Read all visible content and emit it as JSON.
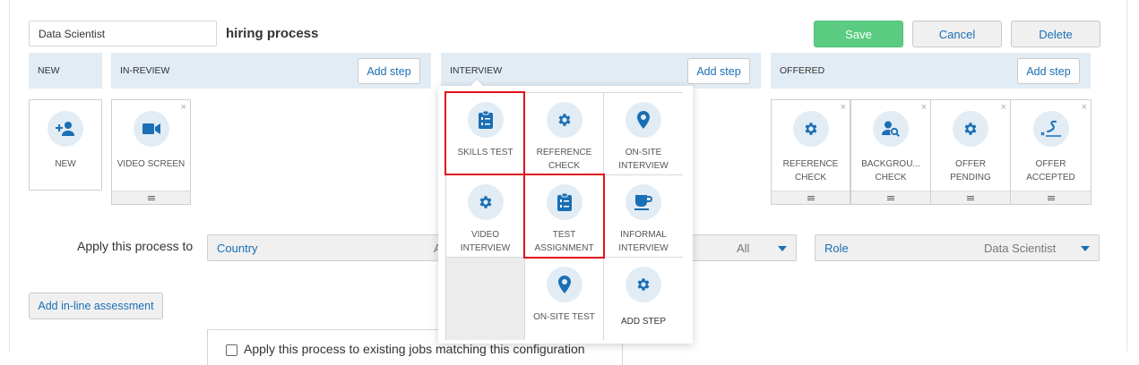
{
  "process": {
    "job_name": "Data Scientist",
    "title": "hiring process"
  },
  "actions": {
    "save": "Save",
    "cancel": "Cancel",
    "delete": "Delete"
  },
  "columns": {
    "new": {
      "label": "NEW"
    },
    "in_review": {
      "label": "IN-REVIEW",
      "add_step": "Add step"
    },
    "interview": {
      "label": "INTERVIEW",
      "add_step": "Add step"
    },
    "offered": {
      "label": "OFFERED",
      "add_step": "Add step"
    }
  },
  "cards": {
    "new": {
      "label": "NEW",
      "icon": "add-person-icon"
    },
    "video_screen": {
      "label": "VIDEO SCREEN",
      "icon": "video-camera-icon"
    },
    "reference_check": {
      "label": "REFERENCE CHECK",
      "icon": "gear-icon"
    },
    "background_check": {
      "label": "BACKGROU... CHECK",
      "icon": "person-search-icon"
    },
    "offer_pending": {
      "label": "OFFER PENDING",
      "icon": "gear-icon"
    },
    "offer_accepted": {
      "label": "OFFER ACCEPTED",
      "icon": "signature-icon"
    },
    "close_glyph": "×"
  },
  "step_picker": {
    "items": [
      {
        "label": "SKILLS TEST",
        "icon": "clipboard-list-icon",
        "highlighted": true
      },
      {
        "label": "REFERENCE CHECK",
        "icon": "gear-icon"
      },
      {
        "label": "ON-SITE INTERVIEW",
        "icon": "map-pin-icon"
      },
      {
        "label": "VIDEO INTERVIEW",
        "icon": "gear-icon"
      },
      {
        "label": "TEST ASSIGNMENT",
        "icon": "clipboard-list-icon",
        "highlighted": true
      },
      {
        "label": "INFORMAL INTERVIEW",
        "icon": "coffee-cup-icon"
      },
      {
        "label": "ON-SITE TEST",
        "icon": "map-pin-icon"
      },
      {
        "label": "ADD STEP",
        "icon": "gear-icon"
      }
    ]
  },
  "apply": {
    "label": "Apply this process to",
    "country": {
      "name": "Country",
      "value": "A"
    },
    "middle": {
      "value": "All"
    },
    "role": {
      "name": "Role",
      "value": "Data Scientist"
    }
  },
  "inline_assessment": {
    "label": "Add in-line assessment"
  },
  "existing_jobs": {
    "label": "Apply this process to existing jobs matching this configuration"
  },
  "colors": {
    "accent": "#1a6fb5",
    "save": "#5ccc82",
    "header_bg": "#e2ecf5",
    "highlight": "#e0131b"
  }
}
